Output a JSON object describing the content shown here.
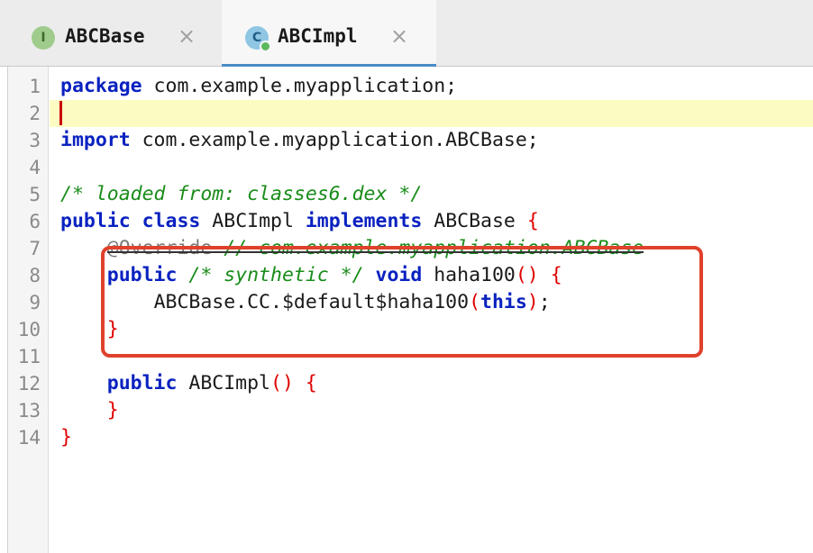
{
  "tabs": [
    {
      "label": "ABCBase",
      "icon_letter": "I",
      "icon": "interface-icon",
      "close": "×"
    },
    {
      "label": "ABCImpl",
      "icon_letter": "C",
      "icon": "class-icon",
      "close": "×"
    }
  ],
  "line_numbers": [
    "1",
    "2",
    "3",
    "4",
    "5",
    "6",
    "7",
    "8",
    "9",
    "10",
    "11",
    "12",
    "13",
    "14"
  ],
  "code": {
    "l1": {
      "kw": "package",
      "rest": " com.example.myapplication;"
    },
    "l3": {
      "kw": "import",
      "rest": " com.example.myapplication.ABCBase;"
    },
    "l5": {
      "comment": "/* loaded from: classes6.dex */"
    },
    "l6": {
      "kw1": "public",
      "kw2": "class",
      "name": " ABCImpl ",
      "kw3": "implements",
      "base": " ABCBase ",
      "brace": "{"
    },
    "l7": {
      "indent": "    ",
      "annotation": "@Override",
      "comment": " // com.example.myapplication.ABCBase"
    },
    "l8": {
      "indent": "    ",
      "kw1": "public",
      "comment": " /* synthetic */ ",
      "kw2": "void",
      "name": " haha100",
      "paren": "()",
      "brace": " {"
    },
    "l9": {
      "indent": "        ",
      "call": "ABCBase.CC.$default$haha100",
      "paren_open": "(",
      "kw": "this",
      "paren_close": ")",
      "end": ";"
    },
    "l10": {
      "indent": "    ",
      "brace": "}"
    },
    "l12": {
      "indent": "    ",
      "kw": "public",
      "name": " ABCImpl",
      "paren": "()",
      "brace": " {"
    },
    "l13": {
      "indent": "    ",
      "brace": "}"
    },
    "l14": {
      "brace": "}"
    }
  },
  "colors": {
    "keyword": "#0a22c0",
    "comment": "#198c19",
    "brace": "#e00000",
    "highlight_box": "#e0412c",
    "current_line": "#fcfcc2"
  }
}
